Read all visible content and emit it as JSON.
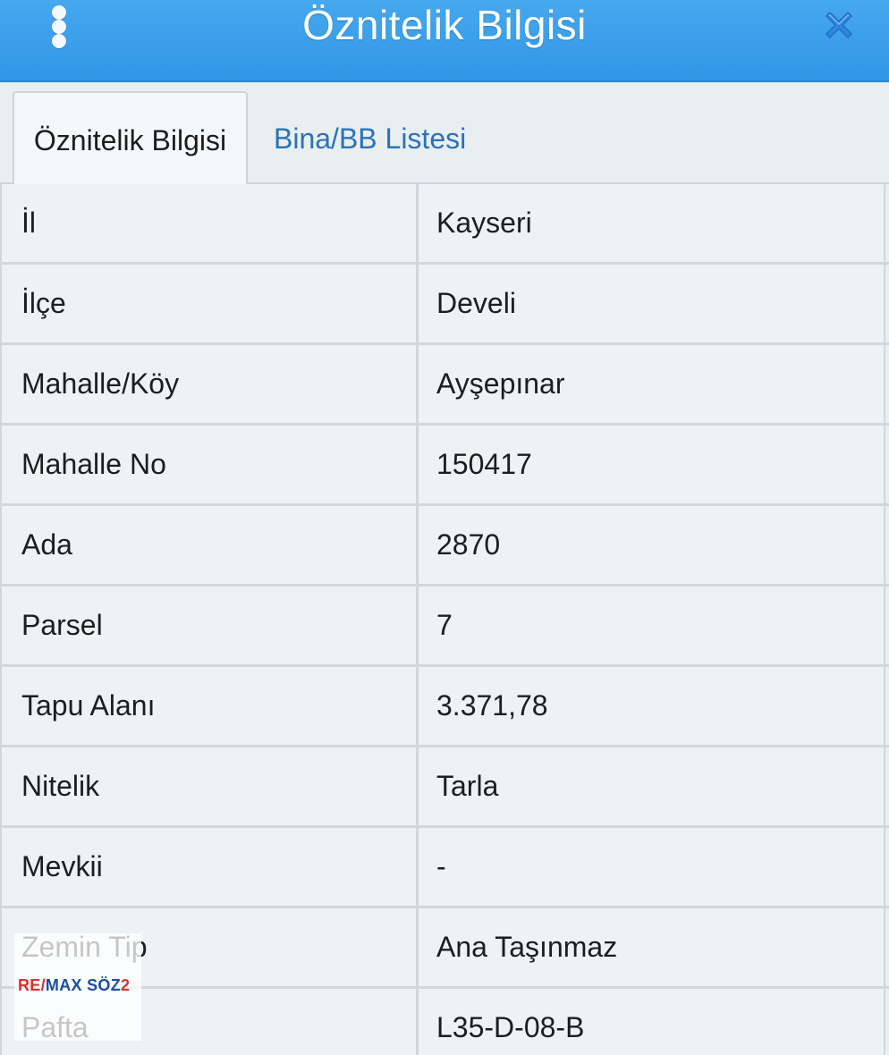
{
  "header": {
    "title": "Öznitelik Bilgisi",
    "menu_icon": "kebab-menu-icon",
    "close_icon": "close-icon"
  },
  "tabs": [
    {
      "label": "Öznitelik Bilgisi",
      "active": true
    },
    {
      "label": "Bina/BB Listesi",
      "active": false
    }
  ],
  "rows": [
    {
      "label": "İl",
      "value": "Kayseri"
    },
    {
      "label": "İlçe",
      "value": "Develi"
    },
    {
      "label": "Mahalle/Köy",
      "value": "Ayşepınar"
    },
    {
      "label": "Mahalle No",
      "value": "150417"
    },
    {
      "label": "Ada",
      "value": "2870"
    },
    {
      "label": "Parsel",
      "value": "7"
    },
    {
      "label": "Tapu Alanı",
      "value": "3.371,78"
    },
    {
      "label": "Nitelik",
      "value": "Tarla"
    },
    {
      "label": "Mevkii",
      "value": "-"
    },
    {
      "label": "Zemin Tip",
      "value": "Ana Taşınmaz"
    },
    {
      "label": "Pafta",
      "value": "L35-D-08-B"
    }
  ],
  "logo": {
    "re": "RE/",
    "max": "MAX",
    "soz": "SÖZ",
    "num": "2"
  },
  "colors": {
    "header_bg": "#3a9eea",
    "tab_link": "#2a73b8",
    "close_icon": "#2f86de",
    "table_bg": "#edf2f5",
    "grid_line": "#cfd8dd"
  }
}
